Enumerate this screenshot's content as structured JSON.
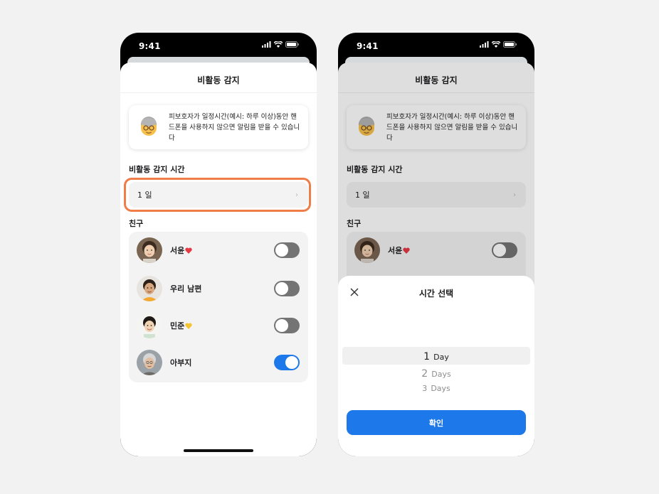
{
  "status_bar": {
    "time": "9:41"
  },
  "screen": {
    "title": "비활동 감지",
    "info_text": "피보호자가 일정시간(예시: 하루 이상)동안 핸드폰을 사용하지 않으면 알림을 받을 수 있습니다",
    "info_icon": "elderly-person-emoji",
    "detection_label": "비활동 감지 시간",
    "detection_value": "1 일",
    "friends_label": "친구"
  },
  "friends": [
    {
      "name": "서윤",
      "badge": "❤️",
      "badge_color": "#e63946",
      "enabled": false
    },
    {
      "name": "우리 남편",
      "badge": "",
      "badge_color": "",
      "enabled": false
    },
    {
      "name": "민준",
      "badge": "💛",
      "badge_color": "#f4c430",
      "enabled": false
    },
    {
      "name": "아부지",
      "badge": "",
      "badge_color": "",
      "enabled": true
    }
  ],
  "picker": {
    "title": "시간 선택",
    "options": [
      {
        "num": "1",
        "unit": "Day"
      },
      {
        "num": "2",
        "unit": "Days"
      },
      {
        "num": "3",
        "unit": "Days"
      }
    ],
    "selected_index": 0,
    "confirm_label": "확인"
  },
  "colors": {
    "accent": "#1d78ea",
    "highlight_border": "#f07c48",
    "toggle_off": "#747474",
    "background": "#f2f2f3"
  }
}
